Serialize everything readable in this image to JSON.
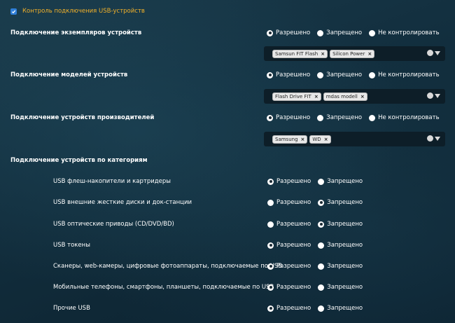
{
  "master": {
    "label": "Контроль подключения USB-устройств",
    "checked": true
  },
  "sections": [
    {
      "label": "Подключение экземпляров устройств",
      "options": [
        "Разрешено",
        "Запрещено",
        "Не контролировать"
      ],
      "selected": 0,
      "tags": [
        {
          "text": "Samsun FIT Flash"
        },
        {
          "text": "Silicon Power"
        }
      ]
    },
    {
      "label": "Подключение моделей устройств",
      "options": [
        "Разрешено",
        "Запрещено",
        "Не контролировать"
      ],
      "selected": 0,
      "tags": [
        {
          "text": "Flash Drive FIT"
        },
        {
          "text": "mdas modell"
        }
      ]
    },
    {
      "label": "Подключение устройств производителей",
      "options": [
        "Разрешено",
        "Запрещено",
        "Не контролировать"
      ],
      "selected": 0,
      "tags": [
        {
          "text": "Samsung"
        },
        {
          "text": "WD"
        }
      ]
    }
  ],
  "categories_title": "Подключение устройств по категориям",
  "tag_remove": "×",
  "categories": [
    {
      "label": "USB флеш-накопители и картридеры",
      "options": [
        "Разрешено",
        "Запрещено"
      ],
      "selected": 0
    },
    {
      "label": "USB внешние жесткие диски и док-станции",
      "options": [
        "Разрешено",
        "Запрещено"
      ],
      "selected": 1
    },
    {
      "label": "USB оптические приводы (CD/DVD/BD)",
      "options": [
        "Разрешено",
        "Запрещено"
      ],
      "selected": 1
    },
    {
      "label": "USB токены",
      "options": [
        "Разрешено",
        "Запрещено"
      ],
      "selected": 0
    },
    {
      "label": "Сканеры, web-камеры, цифровые фотоаппараты, подключаемые по USB",
      "options": [
        "Разрешено",
        "Запрещено"
      ],
      "selected": 0
    },
    {
      "label": "Мобильные телефоны, смартфоны, планшеты, подключаемые по USB",
      "options": [
        "Разрешено",
        "Запрещено"
      ],
      "selected": 0
    },
    {
      "label": "Прочие USB",
      "options": [
        "Разрешено",
        "Запрещено"
      ],
      "selected": 0
    }
  ],
  "colors": {
    "accent": "#f2b12a",
    "checkbox": "#2f7fd8",
    "tagbox_bg": "#0d1e28"
  }
}
